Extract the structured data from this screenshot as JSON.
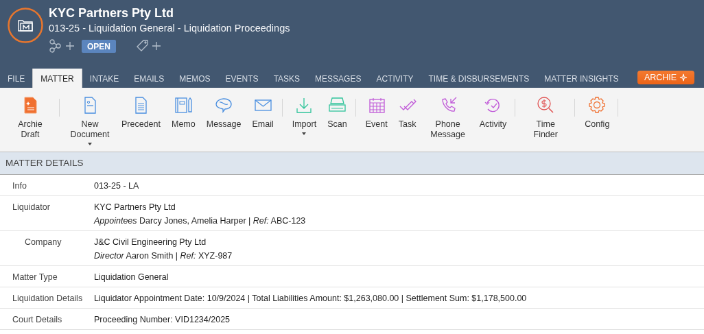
{
  "header": {
    "title": "KYC Partners Pty Ltd",
    "subtitle": "013-25 - Liquidation General - Liquidation Proceedings",
    "status": "OPEN"
  },
  "tabs": [
    {
      "label": "FILE",
      "selected": false
    },
    {
      "label": "MATTER",
      "selected": true
    },
    {
      "label": "INTAKE",
      "selected": false
    },
    {
      "label": "EMAILS",
      "selected": false
    },
    {
      "label": "MEMOS",
      "selected": false
    },
    {
      "label": "EVENTS",
      "selected": false
    },
    {
      "label": "TASKS",
      "selected": false
    },
    {
      "label": "MESSAGES",
      "selected": false
    },
    {
      "label": "ACTIVITY",
      "selected": false
    },
    {
      "label": "TIME & DISBURSEMENTS",
      "selected": false
    },
    {
      "label": "MATTER INSIGHTS",
      "selected": false
    }
  ],
  "archie_button": {
    "label": "ARCHIE"
  },
  "toolbar": [
    [
      {
        "kind": "draft",
        "label": "Archie Draft",
        "dropdown": false
      }
    ],
    [
      {
        "kind": "document",
        "label": "New Document",
        "dropdown": true
      },
      {
        "kind": "precedent",
        "label": "Precedent",
        "dropdown": false
      },
      {
        "kind": "memo",
        "label": "Memo",
        "dropdown": false
      },
      {
        "kind": "message",
        "label": "Message",
        "dropdown": false
      },
      {
        "kind": "email",
        "label": "Email",
        "dropdown": false
      }
    ],
    [
      {
        "kind": "import",
        "label": "Import",
        "dropdown": true
      },
      {
        "kind": "scan",
        "label": "Scan",
        "dropdown": false
      }
    ],
    [
      {
        "kind": "event",
        "label": "Event",
        "dropdown": false
      },
      {
        "kind": "task",
        "label": "Task",
        "dropdown": false
      },
      {
        "kind": "phone",
        "label": "Phone Message",
        "dropdown": false
      },
      {
        "kind": "activity",
        "label": "Activity",
        "dropdown": false
      }
    ],
    [
      {
        "kind": "finder",
        "label": "Time Finder",
        "dropdown": false
      }
    ],
    [
      {
        "kind": "config",
        "label": "Config",
        "dropdown": false
      }
    ]
  ],
  "section": {
    "title": "MATTER DETAILS",
    "rows": [
      {
        "label": "Info",
        "lines": [
          "013-25 - LA"
        ]
      },
      {
        "label": "Liquidator",
        "lines": [
          "KYC Partners Pty Ltd",
          "*Appointees* Darcy Jones, Amelia Harper | *Ref:* ABC-123"
        ],
        "children": [
          {
            "label": "Company",
            "lines": [
              "J&C Civil Engineering Pty Ltd",
              "*Director* Aaron Smith | *Ref:* XYZ-987"
            ]
          }
        ]
      },
      {
        "label": "Matter Type",
        "lines": [
          "Liquidation General"
        ]
      },
      {
        "label": "Liquidation Details",
        "lines": [
          "Liquidator Appointment Date: 10/9/2024 | Total Liabilities Amount: $1,263,080.00 | Settlement Sum: $1,178,500.00"
        ]
      },
      {
        "label": "Court Details",
        "lines": [
          "Proceeding Number: VID1234/2025"
        ]
      }
    ]
  }
}
